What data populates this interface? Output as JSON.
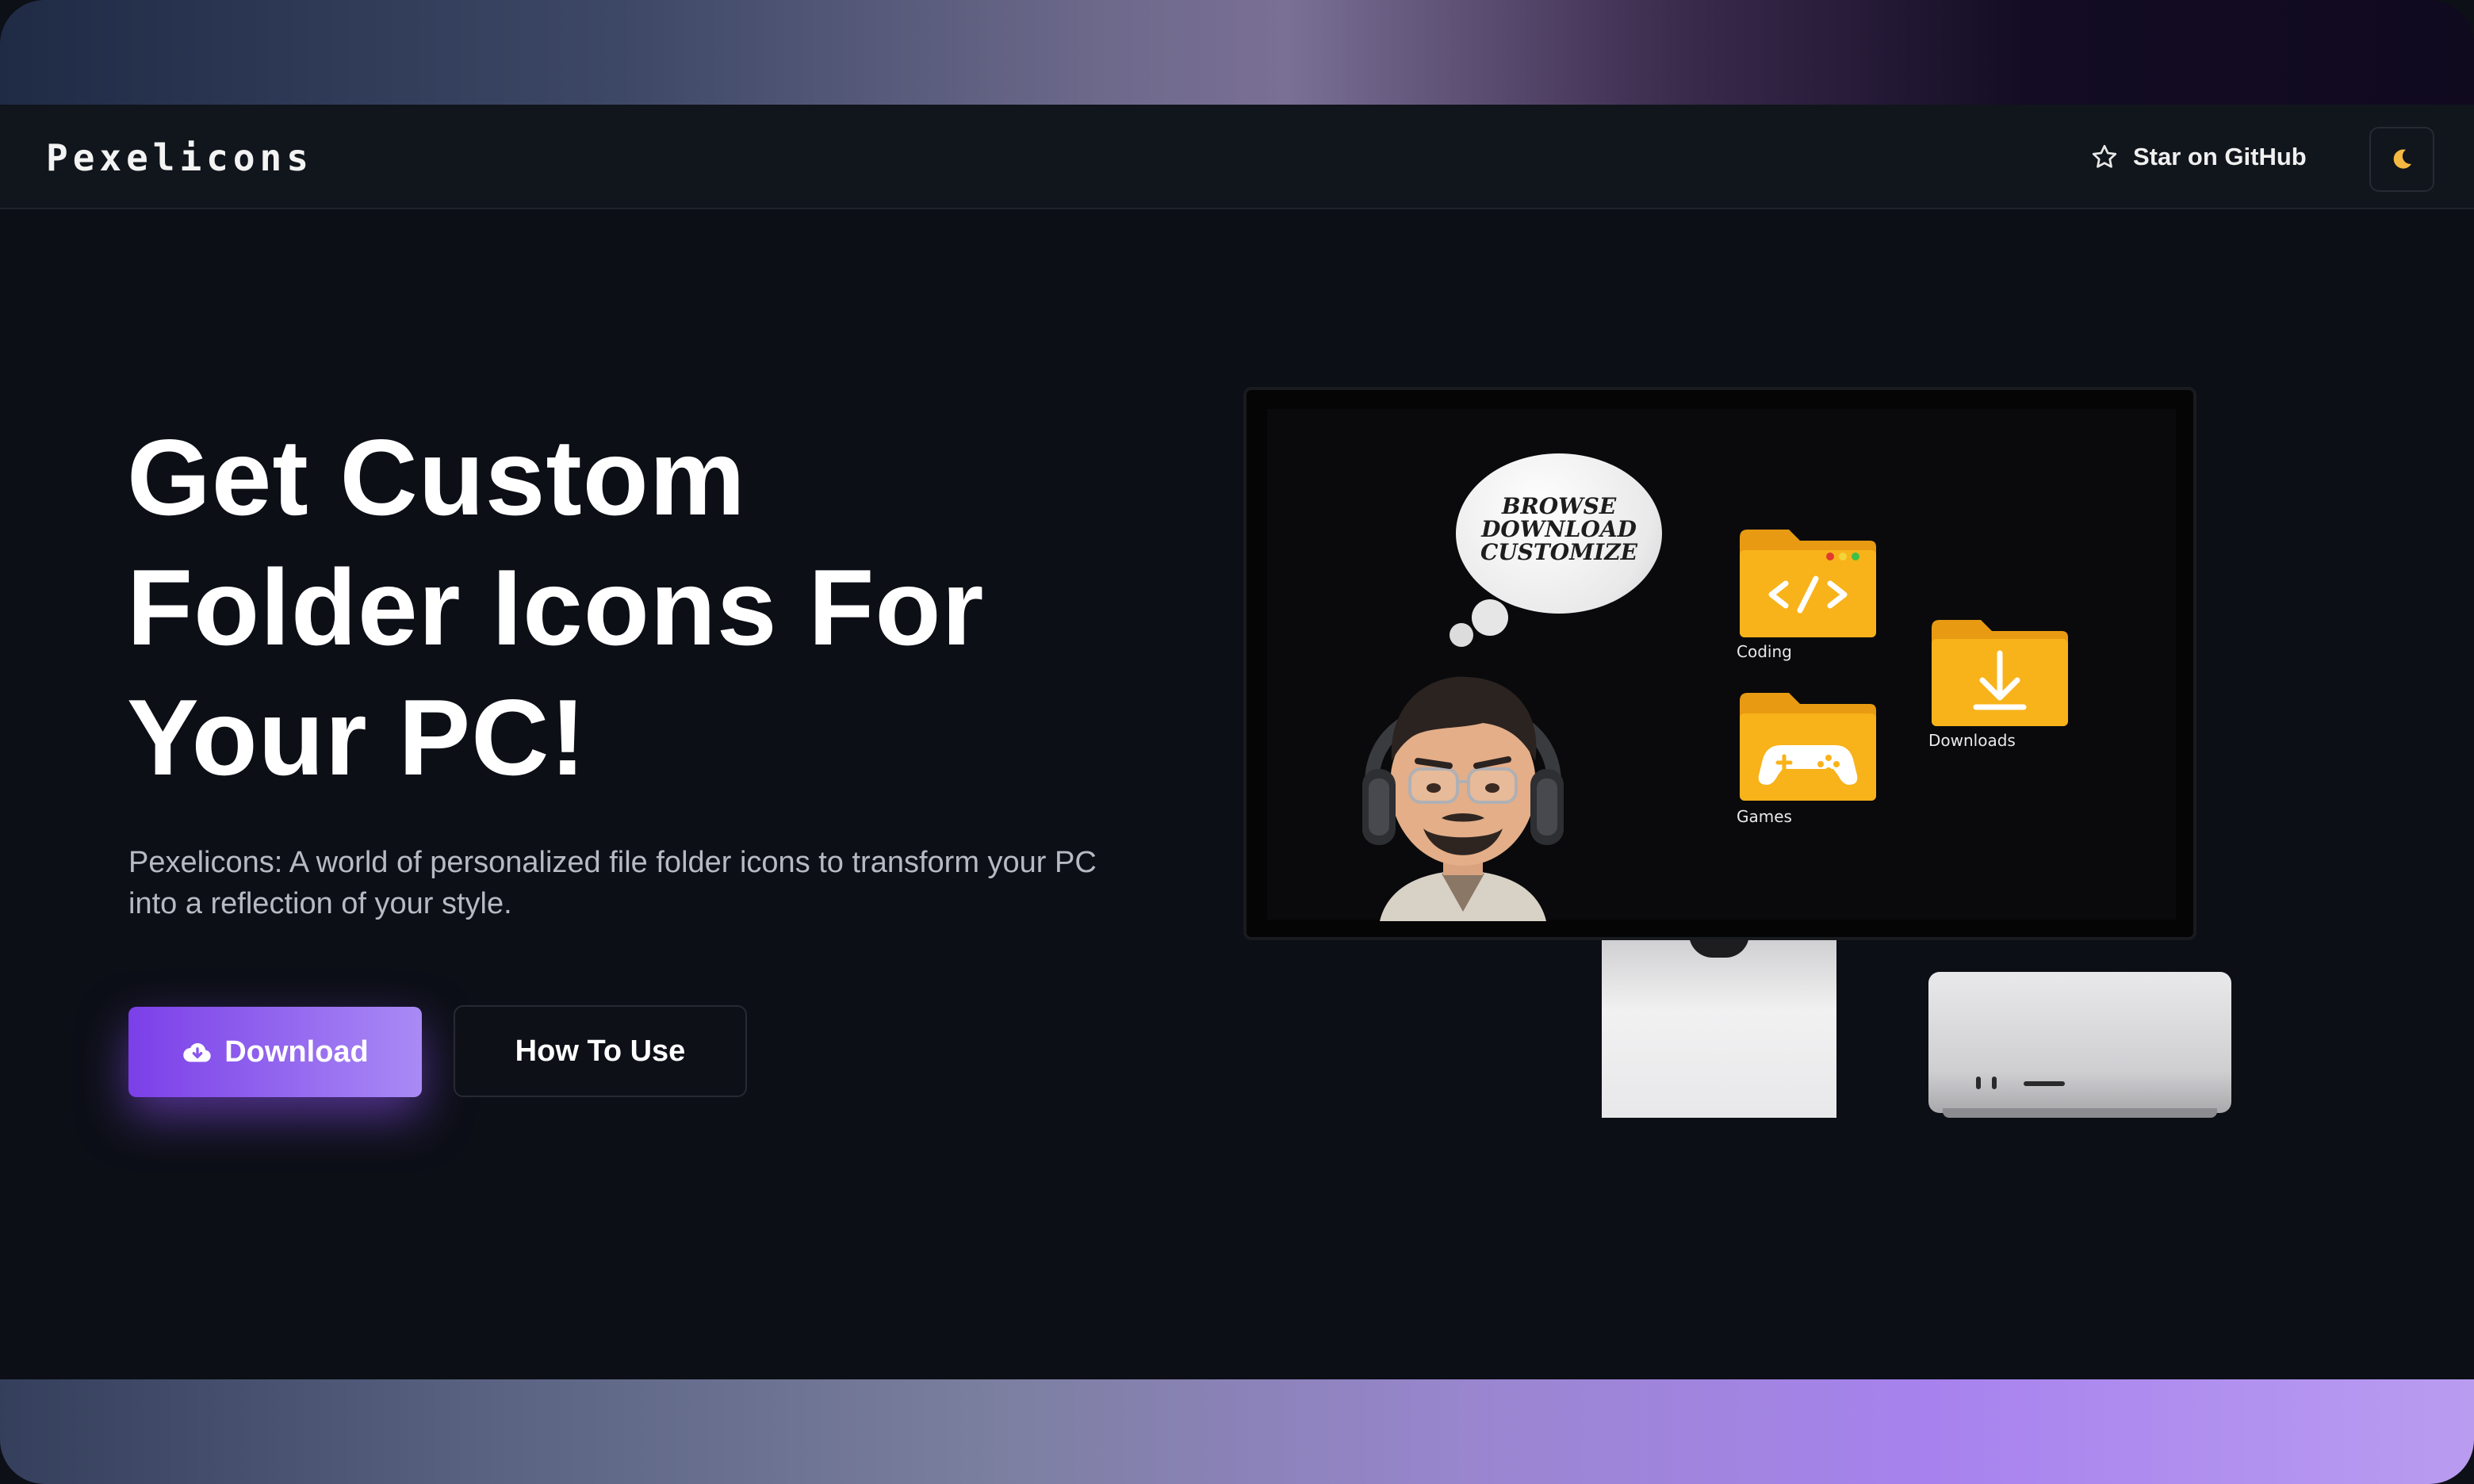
{
  "nav": {
    "logo": "Pexelicons",
    "github_label": "Star on GitHub",
    "theme_icon": "moon-icon"
  },
  "hero": {
    "title_lines": [
      "Get Custom",
      "Folder Icons For",
      "Your PC!"
    ],
    "subtitle": "Pexelicons: A world of personalized file folder icons to transform your PC into a reflection of your style.",
    "download_label": "Download",
    "download_icon": "cloud-download-icon",
    "how_label": "How To Use"
  },
  "illustration": {
    "bubble_lines": [
      "BROWSE",
      "DOWNLOAD",
      "CUSTOMIZE"
    ],
    "folders": [
      {
        "label": "Coding",
        "icon": "code-icon"
      },
      {
        "label": "Games",
        "icon": "gamepad-icon"
      },
      {
        "label": "Downloads",
        "icon": "download-arrow-icon"
      }
    ]
  },
  "colors": {
    "accent_start": "#7b3fe8",
    "accent_end": "#a98af5",
    "background": "#0c0f16",
    "folder": "#f8b21a",
    "moon": "#f5b942"
  }
}
